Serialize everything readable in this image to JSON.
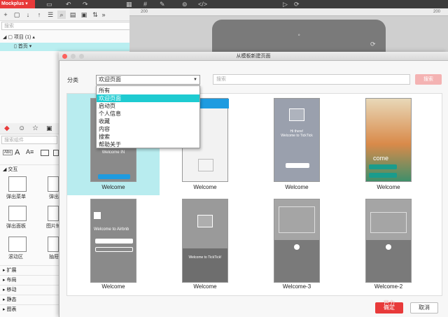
{
  "app": {
    "brand": "Mockplus"
  },
  "left_search": {
    "placeholder": "搜索"
  },
  "tree": {
    "project_label": "项目 (1)",
    "page_label": "首页"
  },
  "ruler": {
    "tick1": "200",
    "tick2": "200"
  },
  "widgets": {
    "search_placeholder": "搜索组件",
    "items": [
      {
        "label": "弹出菜单"
      },
      {
        "label": "弹出"
      },
      {
        "label": "弹出面板"
      },
      {
        "label": "图片轮"
      },
      {
        "label": "滚动区"
      },
      {
        "label": "抽屉"
      }
    ],
    "sections": [
      "交互",
      "扩展",
      "布局",
      "移动",
      "静态",
      "图表"
    ]
  },
  "dialog": {
    "title": "从模板新建页面",
    "category_label": "分类",
    "category_value": "欢迎页面",
    "search_placeholder": "搜索",
    "search_button": "搜索",
    "ok_button": "确定",
    "cancel_button": "取消",
    "ok_overlay": "已力"
  },
  "dropdown": {
    "options": [
      "所有",
      "欢迎页面",
      "启动页",
      "个人信息",
      "收藏",
      "内容",
      "搜索",
      "帮助关于"
    ],
    "selected": "欢迎页面"
  },
  "templates": [
    {
      "label": "Welcome",
      "title": "Welcome IN"
    },
    {
      "label": "Welcome"
    },
    {
      "label": "Welcome",
      "title": "Hi there!\nWelcome to TickTick"
    },
    {
      "label": "Welcome",
      "title": "come"
    },
    {
      "label": "Welcome",
      "title": "Welcome to Airbnb"
    },
    {
      "label": "Welcome",
      "title": "Welcome to TickTick!"
    },
    {
      "label": "Welcome-3"
    },
    {
      "label": "Welcome-2"
    }
  ],
  "colors": {
    "brand_red": "#e83a3a",
    "accent_cyan": "#1ecbd1",
    "selected_bg": "#b8ecef"
  }
}
